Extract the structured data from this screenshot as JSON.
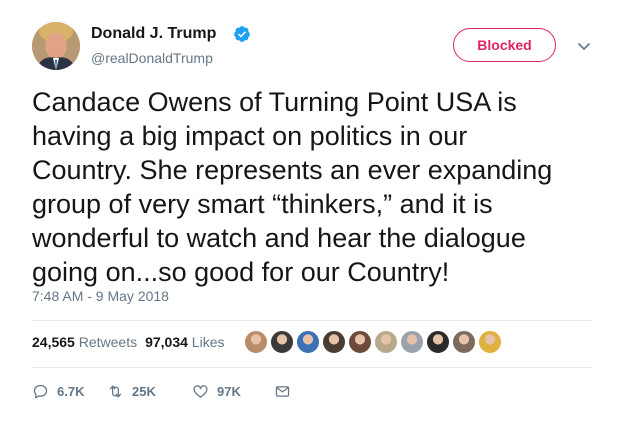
{
  "author": {
    "name": "Donald J. Trump",
    "handle": "@realDonaldTrump",
    "verified": true
  },
  "header": {
    "blocked_label": "Blocked"
  },
  "tweet": {
    "text": "Candace Owens of Turning Point USA is\nhaving a big impact on politics in our\nCountry. She represents an ever expanding\ngroup of very smart “thinkers,” and it is\nwonderful to watch and hear the dialogue\ngoing on...so good for our Country!",
    "timestamp": "7:48 AM - 9 May 2018"
  },
  "stats": {
    "retweets_count": "24,565",
    "retweets_label": "Retweets",
    "likes_count": "97,034",
    "likes_label": "Likes"
  },
  "likers": [
    {
      "color": "#b98c6a"
    },
    {
      "color": "#3a3a3a"
    },
    {
      "color": "#3b6fb6"
    },
    {
      "color": "#4a3b33"
    },
    {
      "color": "#6b4a3a"
    },
    {
      "color": "#b7a98a"
    },
    {
      "color": "#9aa3ab"
    },
    {
      "color": "#2a2a2a"
    },
    {
      "color": "#7c6b5c"
    },
    {
      "color": "#e0b040"
    }
  ],
  "actions": {
    "reply_count": "6.7K",
    "retweet_count": "25K",
    "like_count": "97K"
  },
  "colors": {
    "blocked": "#e0245e",
    "verified": "#1da1f2",
    "secondary_text": "#657786"
  },
  "icons": [
    "verified-badge-icon",
    "chevron-down-icon",
    "reply-icon",
    "retweet-icon",
    "heart-icon",
    "message-icon"
  ]
}
